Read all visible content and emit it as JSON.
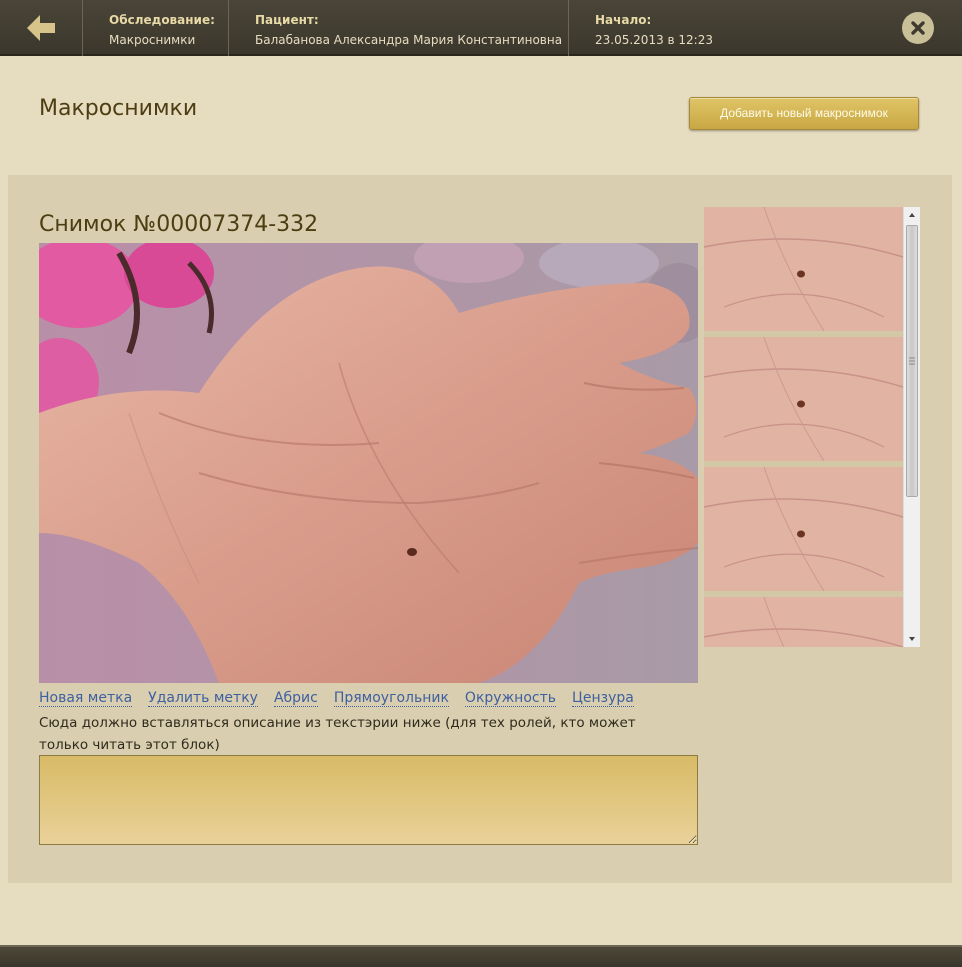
{
  "header": {
    "exam_label": "Обследование:",
    "exam_value": "Макроснимки",
    "patient_label": "Пациент:",
    "patient_value": "Балабанова Александра Мария Константиновна",
    "start_label": "Начало:",
    "start_value": "23.05.2013 в 12:23"
  },
  "page": {
    "title": "Макроснимки",
    "add_button": "Добавить новый макроснимок"
  },
  "snapshot": {
    "title": "Снимок №00007374-332",
    "tools": [
      "Новая метка",
      "Удалить метку",
      "Абрис",
      "Прямоугольник",
      "Окружность",
      "Цензура"
    ],
    "description": "Сюда должно вставляться описание из текстэрии ниже (для тех ролей, кто может только читать этот блок)",
    "textarea_value": ""
  },
  "thumbnails": {
    "count": 4
  },
  "icons": {
    "back": "arrow-left-icon",
    "close": "close-icon",
    "scroll_up": "triangle-up-icon",
    "scroll_down": "triangle-down-icon"
  },
  "colors": {
    "accent_gold": "#cfae4b",
    "header_bg": "#433f33",
    "link_blue": "#3e5fa0",
    "page_bg": "#e6dcc0"
  }
}
